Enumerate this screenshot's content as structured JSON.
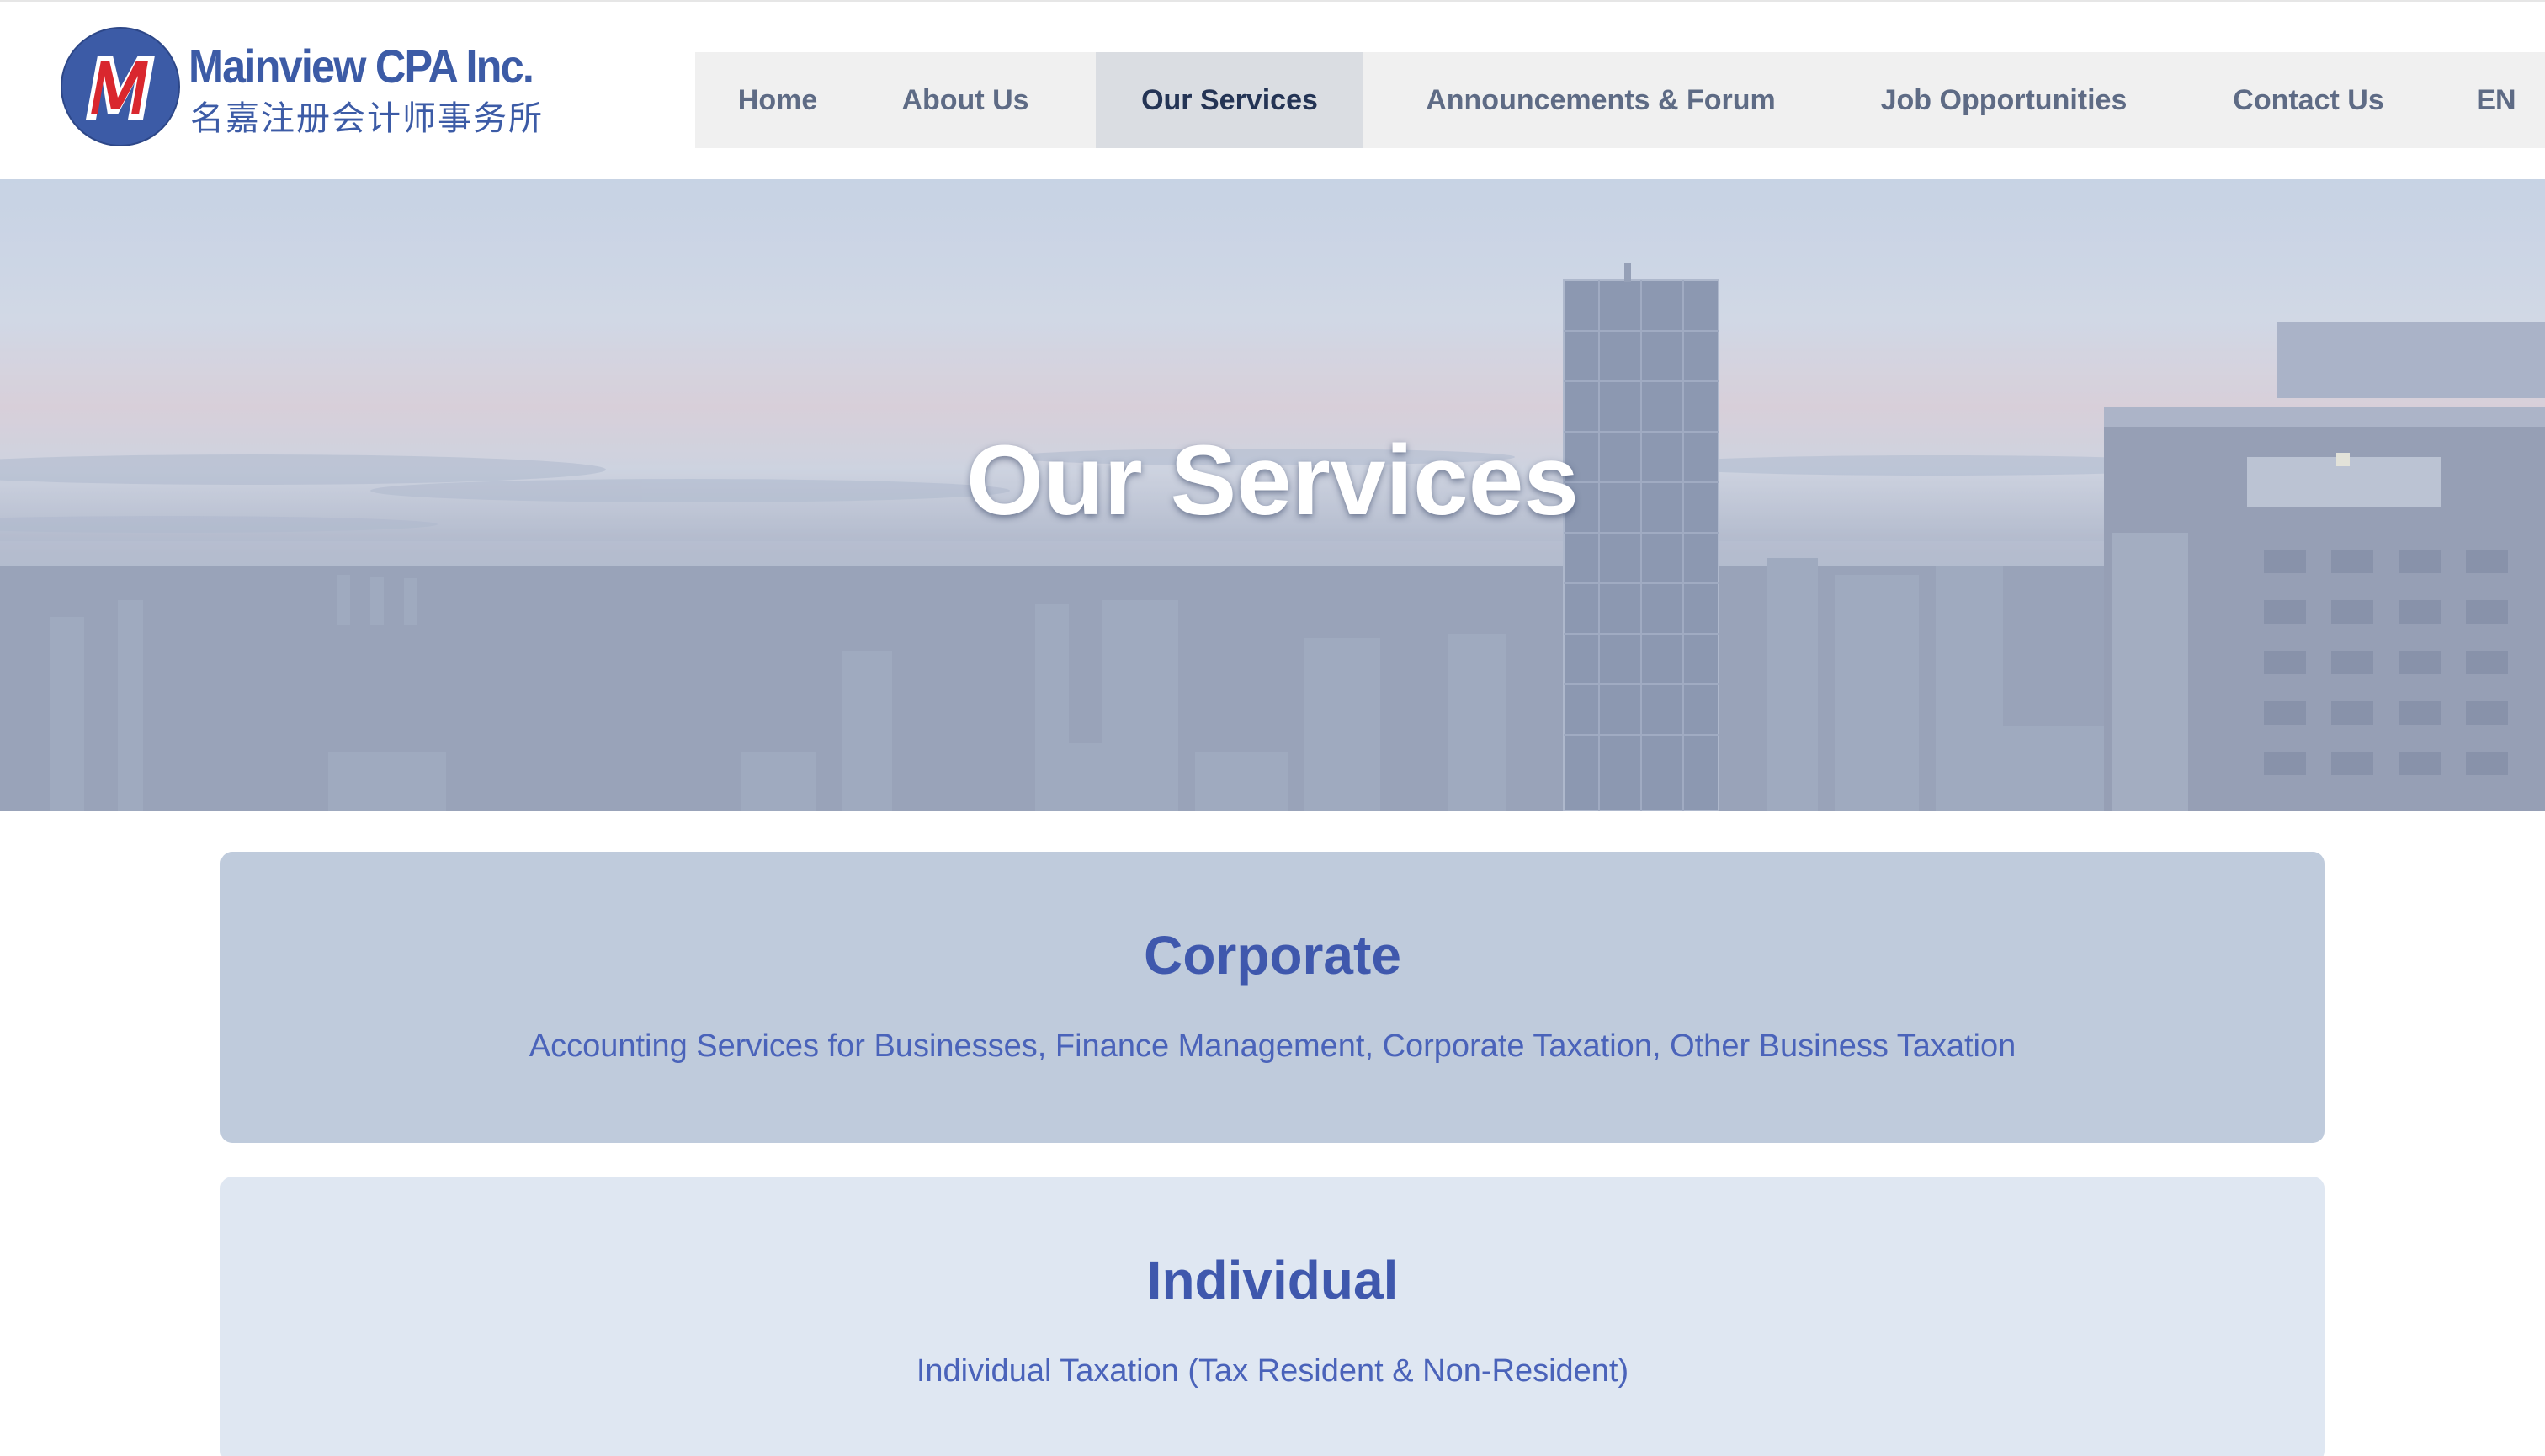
{
  "brand": {
    "name_en": "Mainview CPA Inc.",
    "name_zh": "名嘉注册会计师事务所",
    "logo_letter": "M"
  },
  "nav": {
    "items": [
      {
        "label": "Home",
        "active": false
      },
      {
        "label": "About Us",
        "active": false
      },
      {
        "label": "Our Services",
        "active": true
      },
      {
        "label": "Announcements & Forum",
        "active": false
      },
      {
        "label": "Job Opportunities",
        "active": false
      },
      {
        "label": "Contact Us",
        "active": false
      },
      {
        "label": "EN",
        "active": false
      }
    ]
  },
  "hero": {
    "title": "Our Services"
  },
  "services": [
    {
      "title": "Corporate",
      "description": "Accounting Services for Businesses, Finance Management, Corporate Taxation, Other Business Taxation"
    },
    {
      "title": "Individual",
      "description": "Individual Taxation (Tax Resident & Non-Resident)"
    }
  ],
  "colors": {
    "brand_blue": "#3c5ba6",
    "logo_red": "#d9272e",
    "card_corporate_bg": "#bfcbdc",
    "card_individual_bg": "#dfe7f2",
    "card_text": "#3f58ad",
    "nav_bg": "#f0f0f0",
    "nav_active_bg": "#dadde2"
  }
}
